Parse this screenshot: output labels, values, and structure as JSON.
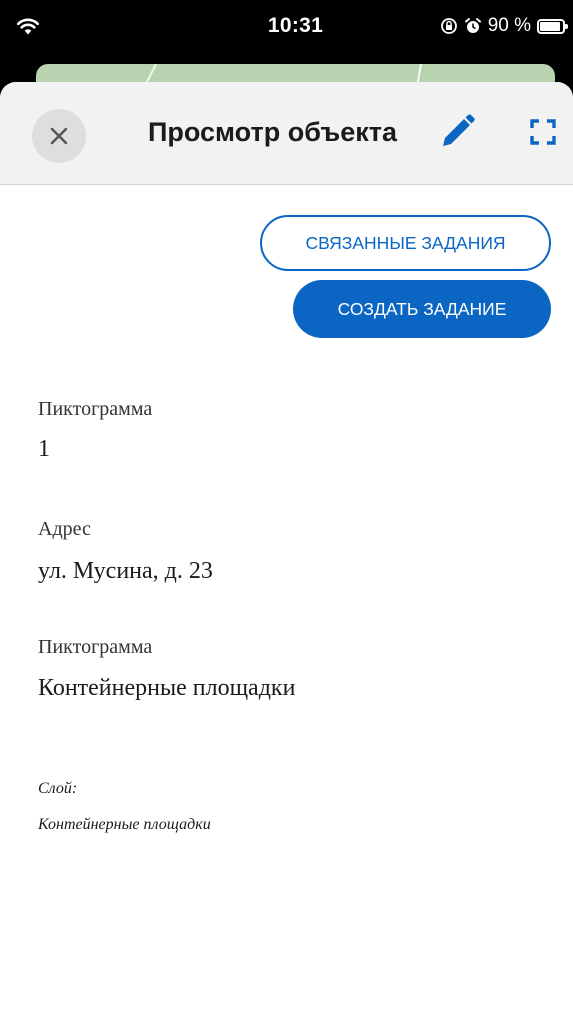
{
  "status_bar": {
    "time": "10:31",
    "battery_percent": "90 %",
    "battery_level": 0.9,
    "icons": [
      "wifi-icon",
      "orientation-lock-icon",
      "alarm-icon",
      "battery-icon"
    ]
  },
  "header": {
    "title": "Просмотр объекта",
    "icons": [
      "close-icon",
      "pencil-icon",
      "fullscreen-icon"
    ]
  },
  "actions": {
    "related_tasks": "СВЯЗАННЫЕ ЗАДАНИЯ",
    "create_task": "СОЗДАТЬ ЗАДАНИЕ"
  },
  "fields": [
    {
      "label": "Пиктограмма",
      "value": "1"
    },
    {
      "label": "Адрес",
      "value": "ул. Мусина, д. 23"
    },
    {
      "label": "Пиктограмма",
      "value": "Контейнерные площадки"
    }
  ],
  "layer": {
    "label": "Слой:",
    "value": "Контейнерные площадки"
  },
  "colors": {
    "accent": "#0a66c2",
    "header_bg": "#f2f2f2",
    "map_green": "#b9d3b0"
  }
}
